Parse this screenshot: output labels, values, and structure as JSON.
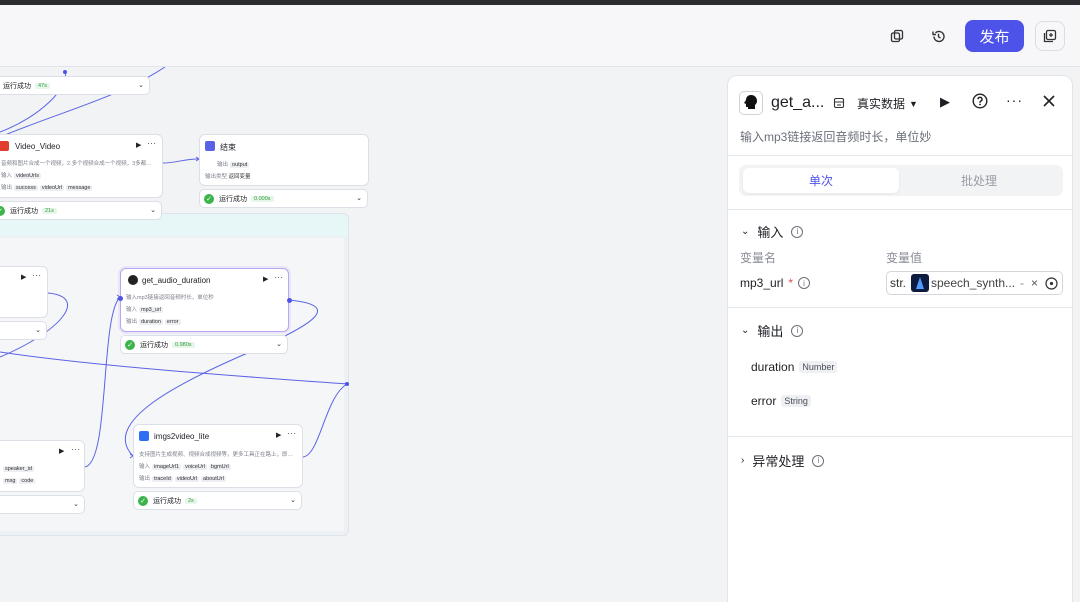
{
  "header": {
    "publish_label": "发布",
    "icons": [
      "copy-icon",
      "history-icon",
      "add-page-icon"
    ]
  },
  "canvas": {
    "top_status": {
      "label": "运行成功",
      "time": "47s"
    },
    "video_node": {
      "title": "Video_Video",
      "desc": "音频和图片合成一个视频，2.多个视频合成一个视频，3多都…",
      "input_label": "输入",
      "inputs": [
        "videoUrls"
      ],
      "output_label": "输出",
      "outputs": [
        "success",
        "videoUrl",
        "message"
      ],
      "status": {
        "label": "运行成功",
        "time": "21s"
      }
    },
    "end_node": {
      "title": "结束",
      "output_label": "输出",
      "output_var": "output",
      "type_label": "输出类型",
      "type_value": "返回变量",
      "status": {
        "label": "运行成功",
        "time": "0.000s"
      }
    },
    "get_audio_node": {
      "title": "get_audio_duration",
      "desc": "输入mp3链接返回音频时长，单位秒",
      "input_label": "输入",
      "inputs": [
        "mp3_url"
      ],
      "output_label": "输出",
      "outputs": [
        "duration",
        "error"
      ],
      "status": {
        "label": "运行成功",
        "time": "0.980s"
      }
    },
    "left_node": {
      "inputs": [
        "speaker_id"
      ],
      "outputs": [
        "msg",
        "code"
      ]
    },
    "imgs_node": {
      "title": "imgs2video_lite",
      "desc": "支持图片生成视频、视频合成视频等，更多工具正在路上，即…",
      "input_label": "输入",
      "inputs": [
        "imageUrl1",
        "voiceUrl",
        "bgmUrl"
      ],
      "output_label": "输出",
      "outputs": [
        "traceId",
        "videoUrl",
        "aboutUrl"
      ],
      "status": {
        "label": "运行成功",
        "time": "2s"
      }
    }
  },
  "panel": {
    "title": "get_a...",
    "data_mode": "真实数据",
    "description": "输入mp3链接返回音频时长，单位妙",
    "tabs": [
      "单次",
      "批处理"
    ],
    "input_section": "输入",
    "col_name": "变量名",
    "col_value": "变量值",
    "var_name": "mp3_url",
    "required_mark": "*",
    "var_type": "str.",
    "var_value": "speech_synth...",
    "output_section": "输出",
    "outputs": [
      {
        "name": "duration",
        "type": "Number"
      },
      {
        "name": "error",
        "type": "String"
      }
    ],
    "exception_section": "异常处理"
  },
  "colors": {
    "accent": "#4d53e8",
    "success": "#3bb54a"
  }
}
